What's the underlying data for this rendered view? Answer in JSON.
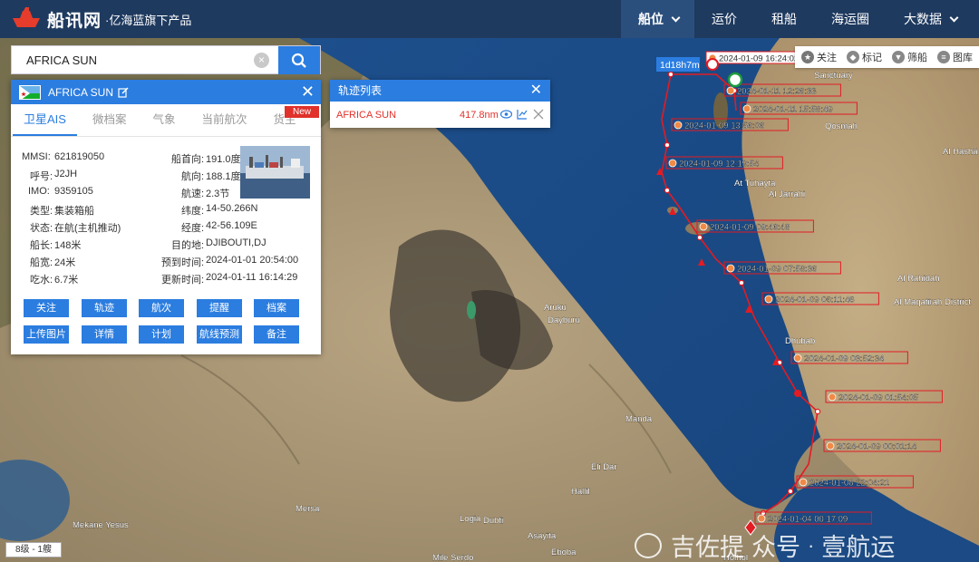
{
  "header": {
    "logo_name": "船讯网",
    "logo_sub": "·亿海蓝旗下产品",
    "nav": [
      "船位",
      "运价",
      "租船",
      "海运圈",
      "大数据"
    ]
  },
  "search": {
    "value": "AFRICA SUN",
    "clear_glyph": "×"
  },
  "ship": {
    "name": "AFRICA SUN",
    "tabs": [
      "卫星AIS",
      "微档案",
      "气象",
      "当前航次",
      "货主"
    ],
    "new_badge": "New",
    "left": [
      {
        "k": "MMSI:",
        "v": "621819050"
      },
      {
        "k": "呼号:",
        "v": "J2JH"
      },
      {
        "k": "IMO:",
        "v": "9359105"
      },
      {
        "k": "类型:",
        "v": "集装箱船"
      },
      {
        "k": "状态:",
        "v": "在航(主机推动)"
      },
      {
        "k": "船长:",
        "v": "148米"
      },
      {
        "k": "船宽:",
        "v": "24米"
      },
      {
        "k": "吃水:",
        "v": "6.7米"
      }
    ],
    "right": [
      {
        "k": "船首向:",
        "v": "191.0度"
      },
      {
        "k": "航向:",
        "v": "188.1度"
      },
      {
        "k": "航速:",
        "v": "2.3节"
      },
      {
        "k": "纬度:",
        "v": "14-50.266N"
      },
      {
        "k": "经度:",
        "v": "42-56.109E"
      },
      {
        "k": "目的地:",
        "v": "DJIBOUTI,DJ"
      },
      {
        "k": "预到时间:",
        "v": "2024-01-01 20:54:00"
      },
      {
        "k": "更新时间:",
        "v": "2024-01-11 16:14:29"
      }
    ],
    "buttons": [
      "关注",
      "轨迹",
      "航次",
      "提醒",
      "档案",
      "上传图片",
      "详情",
      "计划",
      "航线预测",
      "备注"
    ],
    "close_glyph": "✕"
  },
  "track_list": {
    "title": "轨迹列表",
    "ship": "AFRICA SUN",
    "distance": "417.8nm",
    "close_glyph": "✕"
  },
  "map_tools": [
    "关注",
    "标记",
    "筛船",
    "图库"
  ],
  "track": {
    "duration_label": "1d18h7m",
    "points": [
      "2024-01-09 16:24:02",
      "2024-01-11 12:26:33",
      "2024-01-11 15:58:49",
      "2024-01-09 13:56:06",
      "2024-01-09 12:19:54",
      "2024-01-09 09:46:48",
      "2024-01-09 07:58:36",
      "2024-01-09 06:11:46",
      "2024-01-09 03:52:34",
      "2024-01-09 01:54:05",
      "2024-01-09 00:01:14",
      "2024-01-08 22:04:21",
      "2024-01-04 00:17:09"
    ]
  },
  "map_labels": [
    "Sanctuary",
    "Qosmah",
    "Al Jarrahi",
    "At Tuhayta",
    "Dhubab",
    "Aruku",
    "Dayburu",
    "Manda",
    "Eli Dar",
    "Logia",
    "Dubti",
    "Asayita",
    "Mersa",
    "Mekane Yesus",
    "Hallil",
    "Eboba",
    "Mile Serdo",
    "Holhol",
    "Al Rahidah",
    "Al Maqatirah District",
    "Al Hashā District"
  ],
  "scale": "8级 - 1艘",
  "watermark": {
    "left": "吉佐提",
    "mid": "众号",
    "sep": "·",
    "right": "壹航运"
  }
}
